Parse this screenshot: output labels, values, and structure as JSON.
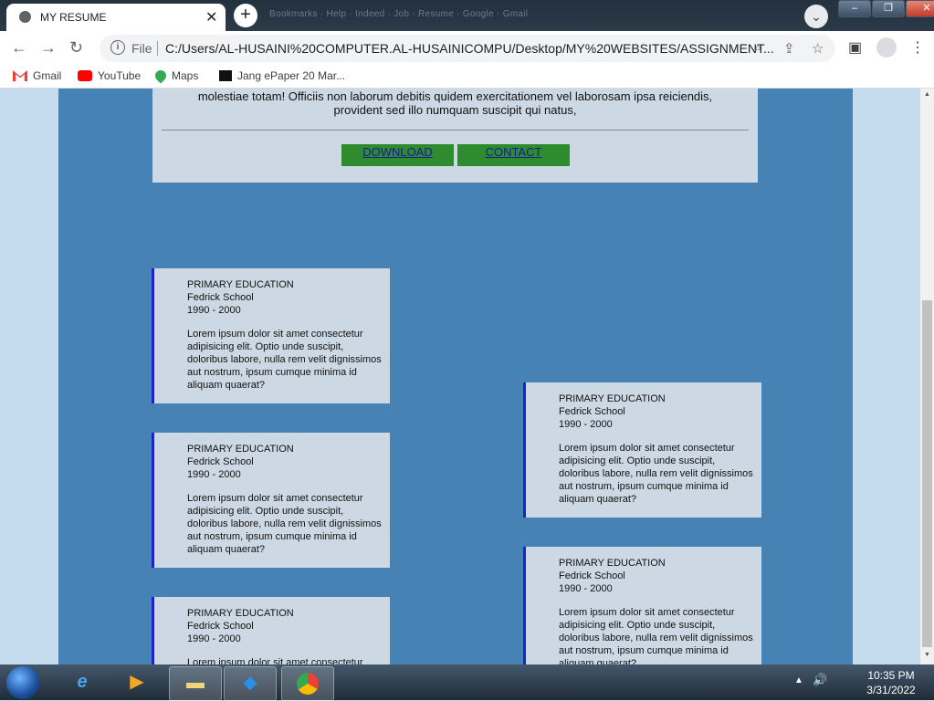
{
  "browser": {
    "tab_title": "MY RESUME",
    "tab_close": "✕",
    "new_tab": "+",
    "blurred_tabs_text": "Bookmarks · Help · Indeed · Job · Resume · Google · Gmail",
    "tab_search": "⌄",
    "window_controls": [
      "–",
      "❐",
      "✕"
    ],
    "toolbar": {
      "back": "←",
      "forward": "→",
      "reload": "↻",
      "info": "i",
      "scheme_label": "File",
      "url": "C:/Users/AL-HUSAINI%20COMPUTER.AL-HUSAINICOMPU/Desktop/MY%20WEBSITES/ASSIGNMENT...",
      "zoom": "⌕",
      "share": "⇪",
      "star": "☆",
      "sidepanel": "▣",
      "menu": "⋮"
    },
    "bookmarks": [
      {
        "label": "Gmail",
        "icon": "gmail-icon",
        "color": "#ea4335"
      },
      {
        "label": "YouTube",
        "icon": "youtube-icon",
        "color": "#ff0000"
      },
      {
        "label": "Maps",
        "icon": "maps-icon",
        "color": "#34a853"
      },
      {
        "label": "Jang ePaper 20 Mar...",
        "icon": "jang-icon",
        "color": "#000000"
      }
    ]
  },
  "resume": {
    "intro_line1": "molestiae totam! Officiis non laborum debitis quidem exercitationem vel laborosam ipsa reiciendis,",
    "intro_line2": "provident sed illo numquam suscipit qui natus,",
    "download_label": "DOWNLOAD",
    "contact_label": "CONTACT",
    "education": [
      {
        "title": "PRIMARY EDUCATION",
        "school": "Fedrick School",
        "years": "1990 - 2000",
        "desc": "Lorem ipsum dolor sit amet consectetur adipisicing elit. Optio unde suscipit, doloribus labore, nulla rem velit dignissimos aut nostrum, ipsum cumque minima id aliquam quaerat?"
      },
      {
        "title": "PRIMARY EDUCATION",
        "school": "Fedrick School",
        "years": "1990 - 2000",
        "desc": "Lorem ipsum dolor sit amet consectetur adipisicing elit. Optio unde suscipit, doloribus labore, nulla rem velit dignissimos aut nostrum, ipsum cumque minima id aliquam quaerat?"
      },
      {
        "title": "PRIMARY EDUCATION",
        "school": "Fedrick School",
        "years": "1990 - 2000",
        "desc": "Lorem ipsum dolor sit amet consectetur adipisicing elit. Optio unde suscipit, doloribus labore, nulla rem velit dignissimos aut nostrum, ipsum cumque minima id aliquam quaerat?"
      },
      {
        "title": "PRIMARY EDUCATION",
        "school": "Fedrick School",
        "years": "1990 - 2000",
        "desc": "Lorem ipsum dolor sit amet consectetur adipisicing elit. Optio unde suscipit, doloribus labore, nulla rem velit dignissimos aut nostrum, ipsum cumque minima id aliquam quaerat?"
      },
      {
        "title": "PRIMARY EDUCATION",
        "school": "Fedrick School",
        "years": "1990 - 2000",
        "desc": "Lorem ipsum dolor sit amet consectetur adipisicing elit. Optio unde suscipit, doloribus labore, nulla rem velit dignissimos aut nostrum, ipsum cumque minima id aliquam quaerat?"
      }
    ]
  },
  "taskbar": {
    "apps": [
      "start-orb",
      "internet-explorer-icon",
      "media-player-icon",
      "file-explorer-icon",
      "vscode-icon",
      "chrome-icon"
    ],
    "tray_up": "▲",
    "volume": "🔊",
    "time": "10:35 PM",
    "date": "3/31/2022"
  },
  "colors": {
    "panel": "#4682b4",
    "card": "#ccd9e4",
    "button": "#2e8b2e",
    "accent_border": "#1a24c8",
    "page_bg": "#c5dbee"
  }
}
